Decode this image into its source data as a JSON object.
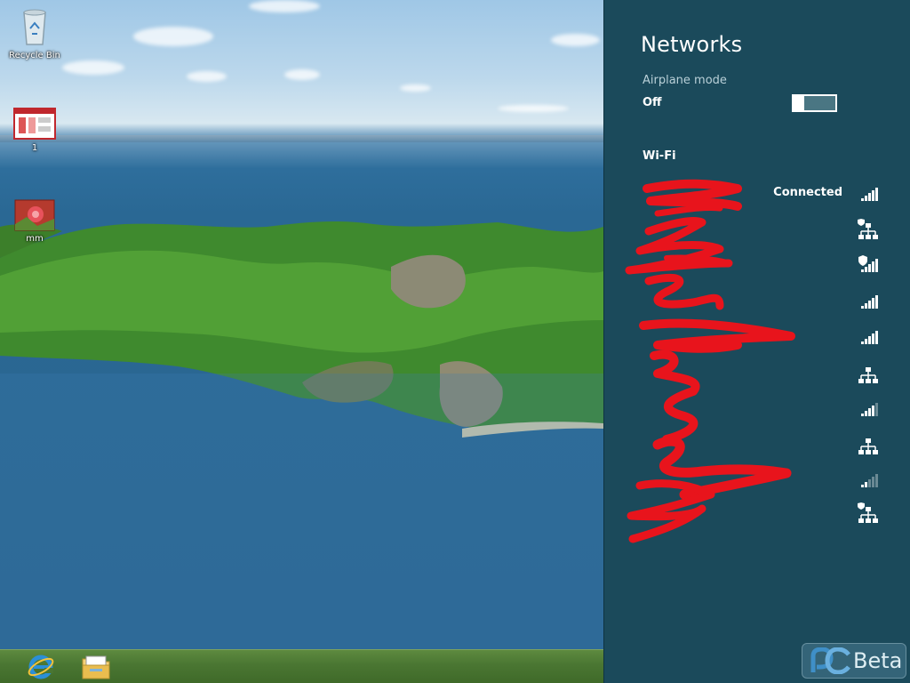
{
  "desktop": {
    "icons": [
      {
        "label": "Recycle Bin",
        "icon": "recycle-bin-icon"
      },
      {
        "label": "1",
        "icon": "document-icon"
      },
      {
        "label": "mm",
        "icon": "image-file-icon"
      }
    ]
  },
  "taskbar": {
    "items": [
      {
        "icon": "internet-explorer-icon"
      },
      {
        "icon": "file-explorer-icon"
      }
    ]
  },
  "charm": {
    "title": "Networks",
    "airplane": {
      "label": "Airplane mode",
      "value": "Off",
      "enabled": false
    },
    "wifi_heading": "Wi-Fi",
    "networks": [
      {
        "name": "",
        "status": "Connected",
        "icon": "wifi-signal-full-icon",
        "signal_bars": 5
      },
      {
        "name": "",
        "status": "",
        "icon": "network-secured-icon"
      },
      {
        "name": "",
        "status": "",
        "icon": "wifi-secured-signal-icon",
        "signal_bars": 5
      },
      {
        "name": "",
        "status": "",
        "icon": "wifi-signal-full-icon",
        "signal_bars": 5
      },
      {
        "name": "",
        "status": "",
        "icon": "wifi-signal-full-icon",
        "signal_bars": 5
      },
      {
        "name": "",
        "status": "",
        "icon": "network-icon"
      },
      {
        "name": "",
        "status": "",
        "icon": "wifi-signal-icon",
        "signal_bars": 4
      },
      {
        "name": "",
        "status": "",
        "icon": "network-icon"
      },
      {
        "name": "",
        "status": "",
        "icon": "wifi-signal-weak-icon",
        "signal_bars": 2
      },
      {
        "name": "",
        "status": "",
        "icon": "network-secured-icon"
      }
    ]
  },
  "watermark": {
    "text": "Beta",
    "icon": "pcbeta-logo-icon"
  },
  "colors": {
    "charm_bg": "#1b4a5b",
    "taskbar": "#4a7632",
    "scribble": "#e8141c"
  }
}
